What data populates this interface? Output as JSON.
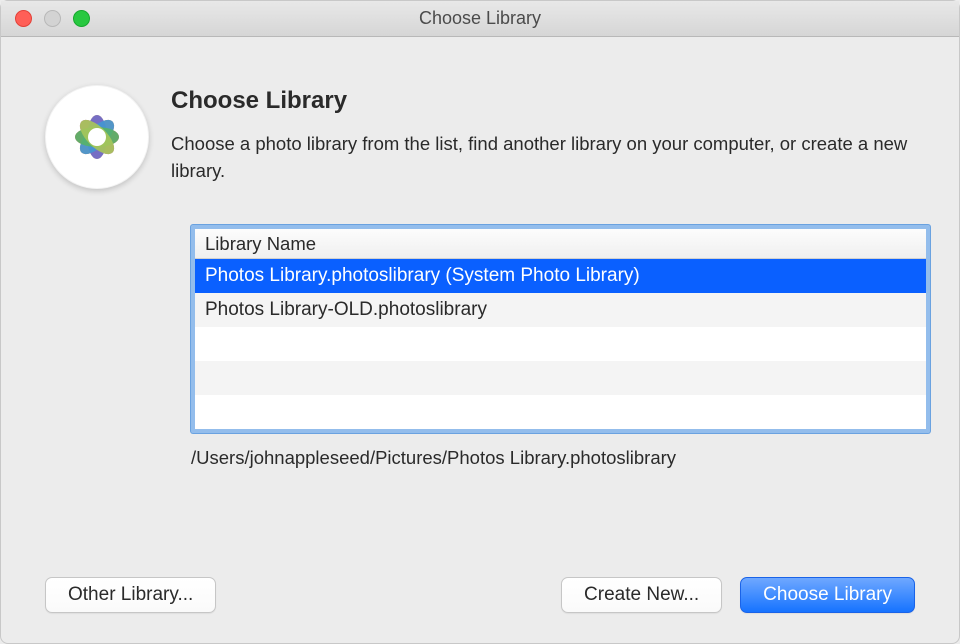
{
  "window": {
    "title": "Choose Library"
  },
  "dialog": {
    "heading": "Choose Library",
    "subheading": "Choose a photo library from the list, find another library on your computer, or create a new library."
  },
  "table": {
    "column_header": "Library Name",
    "rows": [
      "Photos Library.photoslibrary (System Photo Library)",
      "Photos Library-OLD.photoslibrary",
      "",
      "",
      ""
    ],
    "selected_index": 0
  },
  "path_label": "/Users/johnappleseed/Pictures/Photos Library.photoslibrary",
  "buttons": {
    "other": "Other Library...",
    "create": "Create New...",
    "choose": "Choose Library"
  }
}
